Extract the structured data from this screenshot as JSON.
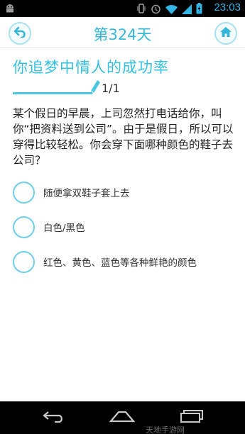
{
  "status_bar": {
    "time": "23:03",
    "icons": [
      "android-icon",
      "vibrate-icon",
      "alarm-icon",
      "wifi-icon",
      "signal-icon",
      "battery-icon"
    ]
  },
  "header": {
    "title": "第324天",
    "back_icon": "back-arrow-icon",
    "home_icon": "home-icon"
  },
  "quiz": {
    "title": "你追梦中情人的成功率",
    "progress": "1/1",
    "question": "某个假日的早晨，上司忽然打电话给你，叫你“把资料送到公司”。由于是假日，所以可以穿得比较轻松。你会穿下面哪种颜色的鞋子去公司？",
    "options": [
      {
        "label": "随便拿双鞋子套上去"
      },
      {
        "label": "白色/黑色"
      },
      {
        "label": "红色、黄色、蓝色等各种鲜艳的颜色"
      }
    ]
  },
  "nav_bar": {
    "buttons": [
      "back-nav-icon",
      "home-nav-icon",
      "recent-apps-icon"
    ],
    "watermark": "天地手游网"
  },
  "colors": {
    "accent": "#35b8d8",
    "radio_border": "#6fcfe6",
    "status_time": "#33b5e5"
  }
}
